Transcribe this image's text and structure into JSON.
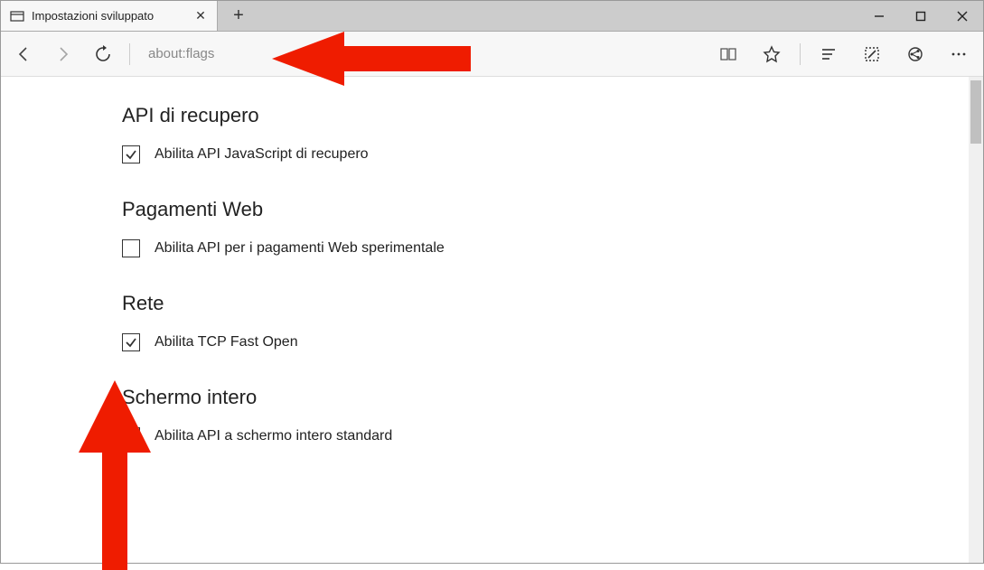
{
  "tab": {
    "title": "Impostazioni sviluppato"
  },
  "url": "about:flags",
  "sections": [
    {
      "heading": "API di recupero",
      "option_label": "Abilita API JavaScript di recupero",
      "checked": true
    },
    {
      "heading": "Pagamenti Web",
      "option_label": "Abilita API per i pagamenti Web sperimentale",
      "checked": false
    },
    {
      "heading": "Rete",
      "option_label": "Abilita TCP Fast Open",
      "checked": true
    },
    {
      "heading": "Schermo intero",
      "option_label": "Abilita API a schermo intero standard",
      "checked": false
    }
  ]
}
